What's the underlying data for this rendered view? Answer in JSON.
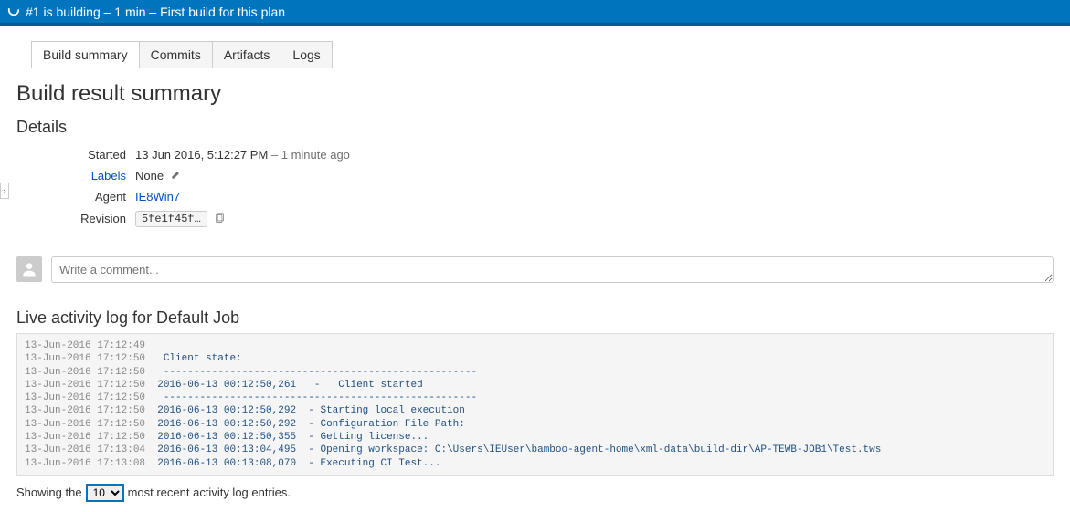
{
  "banner": {
    "text": "#1 is building – 1 min – First build for this plan"
  },
  "tabs": [
    {
      "id": "build-summary",
      "label": "Build summary",
      "active": true
    },
    {
      "id": "commits",
      "label": "Commits",
      "active": false
    },
    {
      "id": "artifacts",
      "label": "Artifacts",
      "active": false
    },
    {
      "id": "logs",
      "label": "Logs",
      "active": false
    }
  ],
  "page_title": "Build result summary",
  "details": {
    "heading": "Details",
    "started_label": "Started",
    "started_value": "13 Jun 2016, 5:12:27 PM",
    "started_relative": " – 1 minute ago",
    "labels_label": "Labels",
    "labels_value": "None",
    "agent_label": "Agent",
    "agent_value": "IE8Win7",
    "revision_label": "Revision",
    "revision_value": "5fe1f45f…"
  },
  "comment": {
    "placeholder": "Write a comment..."
  },
  "log": {
    "heading": "Live activity log for Default Job",
    "lines": [
      {
        "ts": "13-Jun-2016 17:12:49",
        "msg": ""
      },
      {
        "ts": "13-Jun-2016 17:12:50",
        "msg": " Client state:"
      },
      {
        "ts": "13-Jun-2016 17:12:50",
        "msg": " ----------------------------------------------------"
      },
      {
        "ts": "13-Jun-2016 17:12:50",
        "msg": "2016-06-13 00:12:50,261   -   Client started"
      },
      {
        "ts": "13-Jun-2016 17:12:50",
        "msg": " ----------------------------------------------------"
      },
      {
        "ts": "13-Jun-2016 17:12:50",
        "msg": "2016-06-13 00:12:50,292  - Starting local execution"
      },
      {
        "ts": "13-Jun-2016 17:12:50",
        "msg": "2016-06-13 00:12:50,292  - Configuration File Path:"
      },
      {
        "ts": "13-Jun-2016 17:12:50",
        "msg": "2016-06-13 00:12:50,355  - Getting license..."
      },
      {
        "ts": "13-Jun-2016 17:13:04",
        "msg": "2016-06-13 00:13:04,495  - Opening workspace: C:\\Users\\IEUser\\bamboo-agent-home\\xml-data\\build-dir\\AP-TEWB-JOB1\\Test.tws"
      },
      {
        "ts": "13-Jun-2016 17:13:08",
        "msg": "2016-06-13 00:13:08,070  - Executing CI Test..."
      }
    ],
    "showing_prefix": "Showing the",
    "showing_suffix": "most recent activity log entries.",
    "count": "10"
  }
}
